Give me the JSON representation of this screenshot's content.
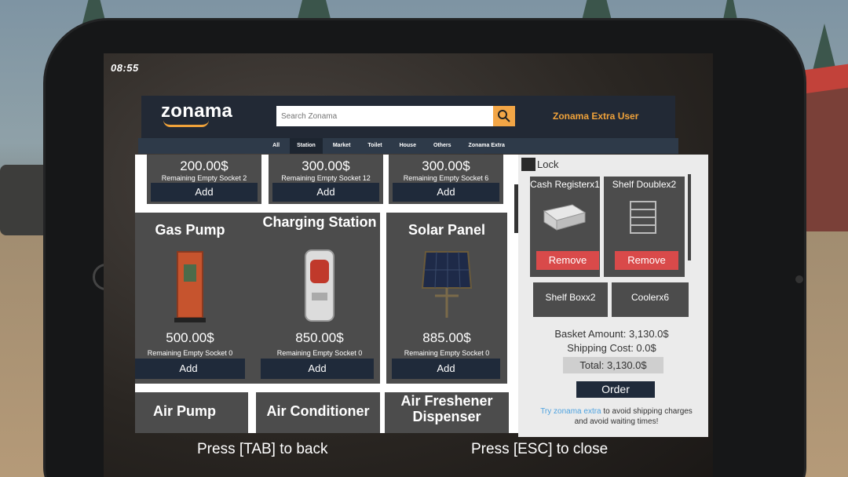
{
  "clock": "08:55",
  "store": {
    "logo": "zonama",
    "search_placeholder": "Search Zonama",
    "user_label": "Zonama Extra User",
    "tabs": [
      "All",
      "Station",
      "Market",
      "Toilet",
      "House",
      "Others",
      "Zonama Extra"
    ],
    "active_tab": "Station"
  },
  "products": [
    {
      "price": "200.00$",
      "socket": "Remaining Empty Socket 2",
      "add": "Add"
    },
    {
      "price": "300.00$",
      "socket": "Remaining Empty Socket 12",
      "add": "Add"
    },
    {
      "price": "300.00$",
      "socket": "Remaining Empty Socket 6",
      "add": "Add"
    },
    {
      "title": "Gas Pump",
      "price": "500.00$",
      "socket": "Remaining Empty Socket 0",
      "add": "Add"
    },
    {
      "title": "Charging Station",
      "price": "850.00$",
      "socket": "Remaining Empty Socket 0",
      "add": "Add"
    },
    {
      "title": "Solar Panel",
      "price": "885.00$",
      "socket": "Remaining Empty Socket 0",
      "add": "Add"
    },
    {
      "title": "Air Pump"
    },
    {
      "title": "Air Conditioner"
    },
    {
      "title": "Air Freshener Dispenser"
    }
  ],
  "basket": {
    "lock_label": "Lock",
    "items": [
      {
        "title": "Cash Registerx1",
        "remove": "Remove"
      },
      {
        "title": "Shelf Doublex2",
        "remove": "Remove"
      },
      {
        "title": "Shelf Boxx2"
      },
      {
        "title": "Coolerx6"
      }
    ],
    "amount": "Basket Amount: 3,130.0$",
    "shipping": "Shipping Cost: 0.0$",
    "total": "Total: 3,130.0$",
    "order": "Order",
    "promo_link": "Try zonama extra",
    "promo_text": " to avoid shipping charges and avoid waiting times!"
  },
  "hints": {
    "back": "Press [TAB] to back",
    "close": "Press [ESC] to close"
  }
}
